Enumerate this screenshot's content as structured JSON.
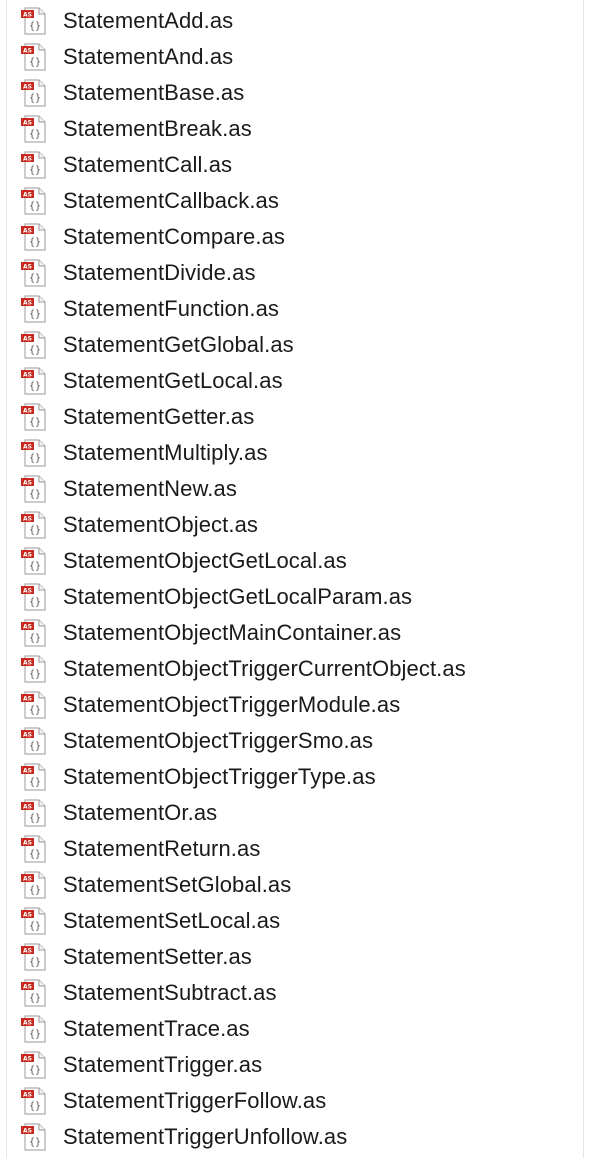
{
  "file_list": {
    "icon": "actionscript-file-icon",
    "icon_badge": "AS",
    "icon_glyph": "{}",
    "colors": {
      "badge_red": "#c8281e",
      "text": "#1a1a1a",
      "page": "#ffffff"
    },
    "items": [
      "StatementAdd.as",
      "StatementAnd.as",
      "StatementBase.as",
      "StatementBreak.as",
      "StatementCall.as",
      "StatementCallback.as",
      "StatementCompare.as",
      "StatementDivide.as",
      "StatementFunction.as",
      "StatementGetGlobal.as",
      "StatementGetLocal.as",
      "StatementGetter.as",
      "StatementMultiply.as",
      "StatementNew.as",
      "StatementObject.as",
      "StatementObjectGetLocal.as",
      "StatementObjectGetLocalParam.as",
      "StatementObjectMainContainer.as",
      "StatementObjectTriggerCurrentObject.as",
      "StatementObjectTriggerModule.as",
      "StatementObjectTriggerSmo.as",
      "StatementObjectTriggerType.as",
      "StatementOr.as",
      "StatementReturn.as",
      "StatementSetGlobal.as",
      "StatementSetLocal.as",
      "StatementSetter.as",
      "StatementSubtract.as",
      "StatementTrace.as",
      "StatementTrigger.as",
      "StatementTriggerFollow.as",
      "StatementTriggerUnfollow.as"
    ]
  }
}
